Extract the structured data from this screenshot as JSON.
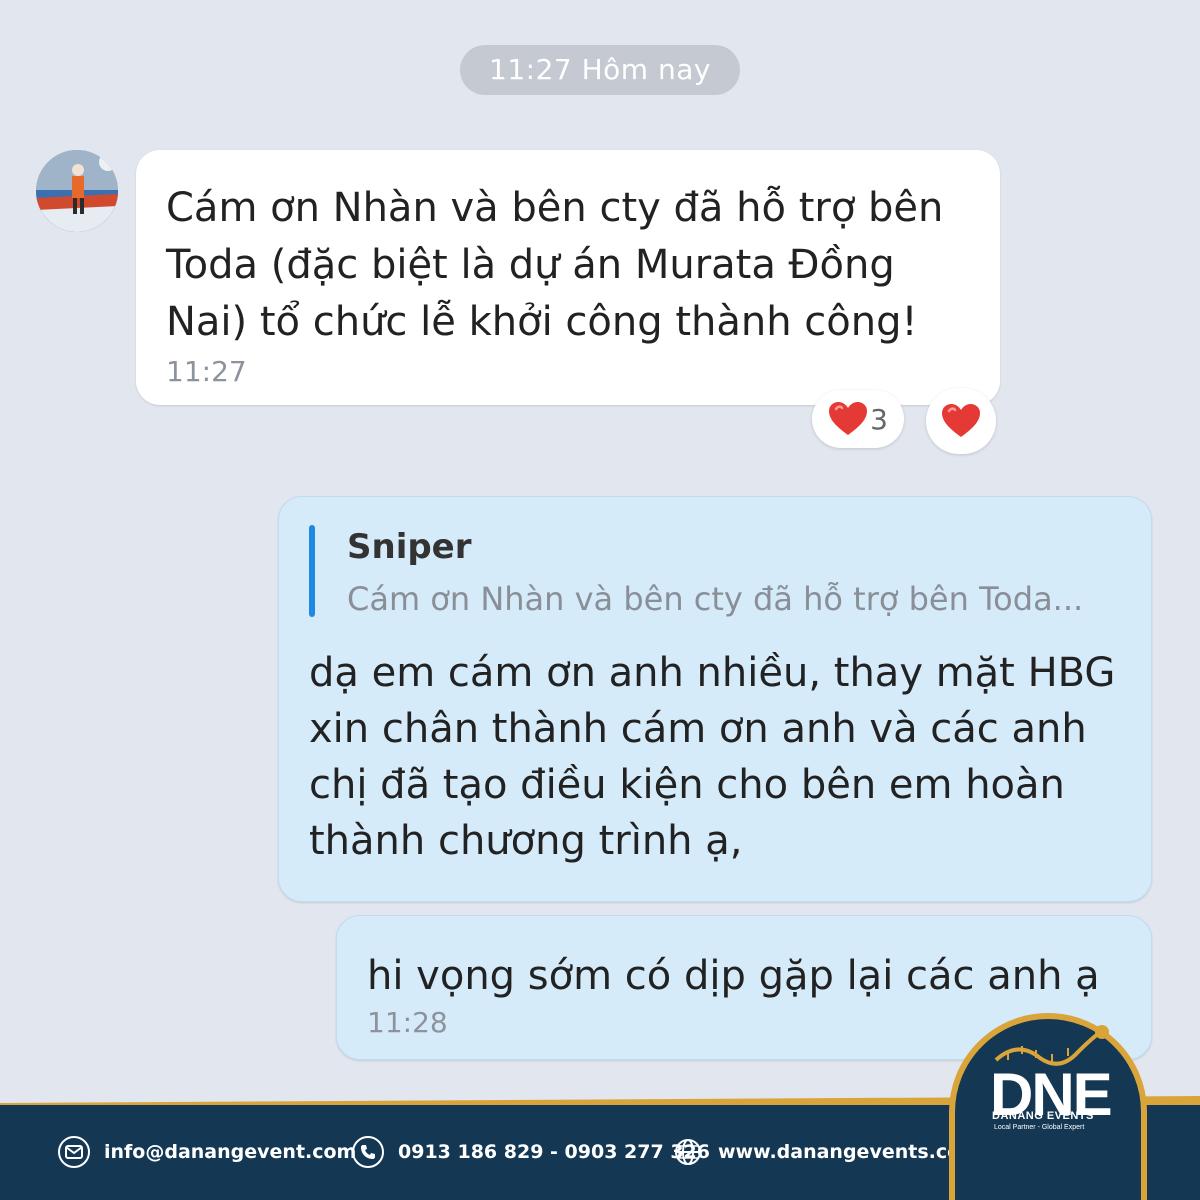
{
  "header": {
    "time_separator": "11:27 Hôm nay"
  },
  "incoming_message": {
    "text": "Cám ơn Nhàn và bên cty đã hỗ trợ bên Toda (đặc biệt là dự án Murata Đồng Nai) tổ chức lễ khởi công thành công!",
    "time": "11:27",
    "reactions": [
      {
        "icon": "heart-icon",
        "count": "3"
      },
      {
        "icon": "heart-icon",
        "count": ""
      }
    ]
  },
  "reply_message": {
    "quote_author": "Sniper",
    "quote_text": "Cám ơn Nhàn và bên cty đã hỗ trợ bên Toda...",
    "text": "dạ em cám ơn anh nhiều, thay mặt HBG xin chân thành cám ơn anh và các anh chị đã tạo điều kiện cho bên em hoàn thành chương trình ạ,"
  },
  "second_message": {
    "text": "hi vọng sớm có dịp gặp lại các anh ạ",
    "time": "11:28"
  },
  "footer": {
    "email": "info@danangevent.com",
    "phone": "0913 186 829 - 0903 277 326",
    "website": "www.danangevents.com.vn",
    "logo_name": "DNE",
    "logo_sub": "DANANG EVENTS",
    "logo_tagline": "Local Partner - Global Expert"
  },
  "colors": {
    "background": "#e2e6ee",
    "outgoing_bubble": "#d5ebfa",
    "quote_bar": "#1e88e5",
    "footer": "#143753",
    "gold": "#d9a53a"
  }
}
